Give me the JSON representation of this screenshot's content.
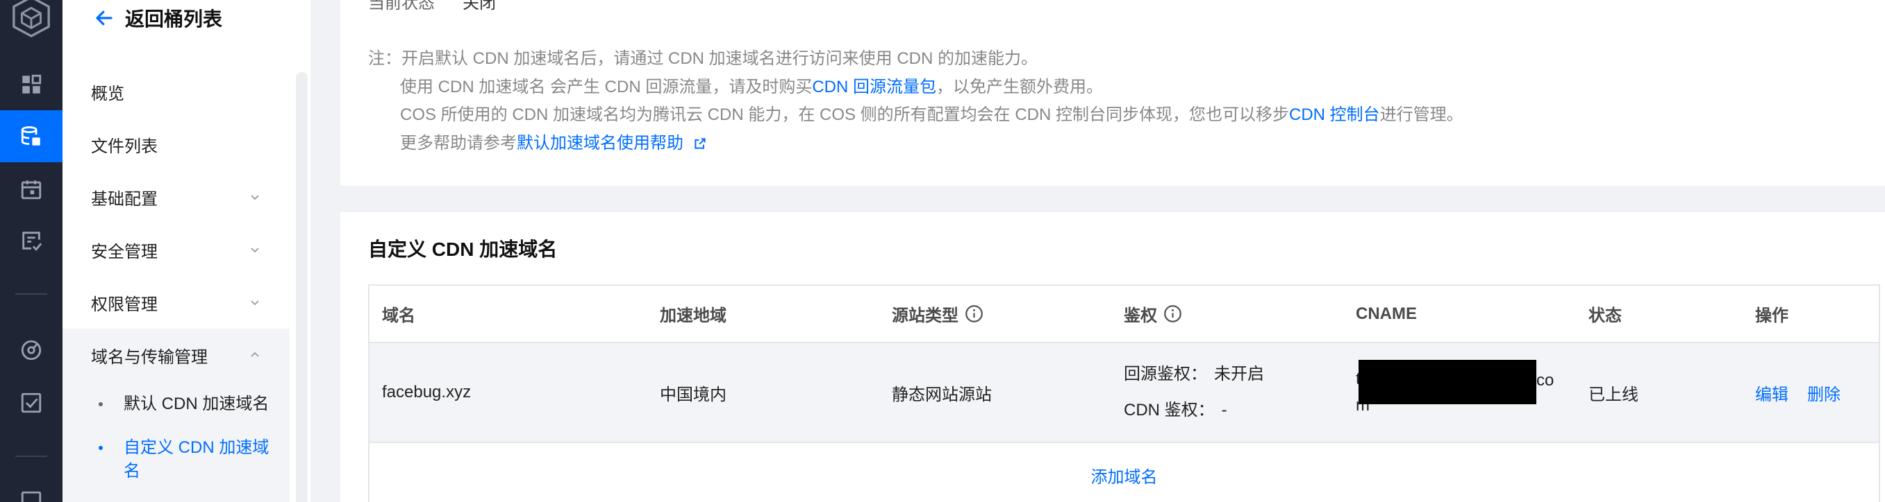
{
  "colors": {
    "primary": "#006eff",
    "rail_background": "#1f2534",
    "page_background": "#f1f2f5",
    "muted_text": "#888888"
  },
  "rail": {
    "icons": [
      "cos-logo-icon",
      "overview-icon",
      "bucket-icon",
      "calendar-icon",
      "task-icon",
      "monitor-icon",
      "check-square-icon",
      "more-icon"
    ],
    "active": "bucket-icon"
  },
  "sidebar": {
    "back_label": "返回桶列表",
    "items": [
      {
        "label": "概览"
      },
      {
        "label": "文件列表"
      },
      {
        "label": "基础配置",
        "expanded": false
      },
      {
        "label": "安全管理",
        "expanded": false
      },
      {
        "label": "权限管理",
        "expanded": false
      },
      {
        "label": "域名与传输管理",
        "expanded": true,
        "children": [
          {
            "label": "默认 CDN 加速域名",
            "active": false
          },
          {
            "label": "自定义 CDN 加速域名",
            "active": true
          }
        ]
      }
    ]
  },
  "default_cdn": {
    "status_label": "当前状态",
    "status_value": "关闭",
    "note_prefix": "注：",
    "note_line1": "开启默认 CDN 加速域名后，请通过 CDN 加速域名进行访问来使用 CDN 的加速能力。",
    "note_line2": {
      "before": "使用 CDN 加速域名 会产生 CDN 回源流量，请及时购买 ",
      "link": "CDN 回源流量包",
      "after": "，以免产生额外费用。"
    },
    "note_line3": {
      "before": "COS 所使用的 CDN 加速域名均为腾讯云 CDN 能力，在 COS 侧的所有配置均会在 CDN 控制台同步体现，您也可以移步 ",
      "link": "CDN 控制台",
      "after": "进行管理。"
    },
    "note_line4": {
      "before": "更多帮助请参考 ",
      "link": "默认加速域名使用帮助",
      "icon": "external-link-icon"
    }
  },
  "custom_cdn": {
    "title": "自定义 CDN 加速域名",
    "columns": [
      {
        "label": "域名"
      },
      {
        "label": "加速地域"
      },
      {
        "label": "源站类型",
        "icon": "info-icon"
      },
      {
        "label": "鉴权",
        "icon": "info-icon"
      },
      {
        "label": "CNAME"
      },
      {
        "label": "状态"
      },
      {
        "label": "操作"
      }
    ],
    "rows": [
      {
        "domain": "facebug.xyz",
        "region": "中国境内",
        "origin_type": "静态网站源站",
        "auth": {
          "origin_label": "回源鉴权：",
          "origin_value": "未开启",
          "cdn_label": "CDN 鉴权：",
          "cdn_value": "-"
        },
        "cname": {
          "visible_start": "t",
          "visible_end": "co",
          "visible_line2": "m",
          "redacted": true
        },
        "status": "已上线",
        "actions": [
          "编辑",
          "删除"
        ]
      }
    ],
    "add_label": "添加域名"
  }
}
